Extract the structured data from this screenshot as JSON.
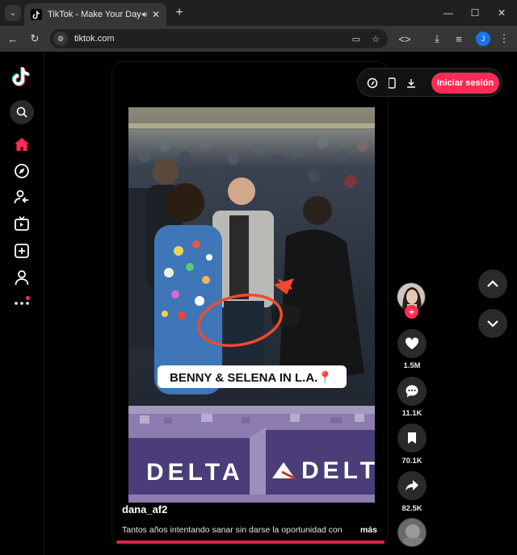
{
  "browser": {
    "tab_title": "TikTok - Make Your Day",
    "url": "tiktok.com",
    "profile_initial": "J"
  },
  "header": {
    "login_label": "Iniciar sesión"
  },
  "sidebar": {
    "items": [
      {
        "name": "search-icon"
      },
      {
        "name": "home-icon",
        "active": true
      },
      {
        "name": "explore-icon"
      },
      {
        "name": "following-icon"
      },
      {
        "name": "live-icon"
      },
      {
        "name": "upload-icon"
      },
      {
        "name": "profile-icon"
      },
      {
        "name": "more-icon"
      }
    ]
  },
  "video": {
    "caption_overlay": "BENNY & SELENA IN L.A.📍",
    "banner_text_left": "DELTA",
    "banner_text_right": "DELT",
    "author": "dana_af2",
    "description": "Tantos años intentando sanar sin darse la oportunidad con",
    "more_label": "más"
  },
  "actions": {
    "likes": "1.5M",
    "comments": "11.1K",
    "saves": "70.1K",
    "shares": "82.5K"
  },
  "colors": {
    "accent": "#fe2c55",
    "background": "#000000",
    "chrome_dark": "#1f2020",
    "chrome_toolbar": "#353636"
  }
}
